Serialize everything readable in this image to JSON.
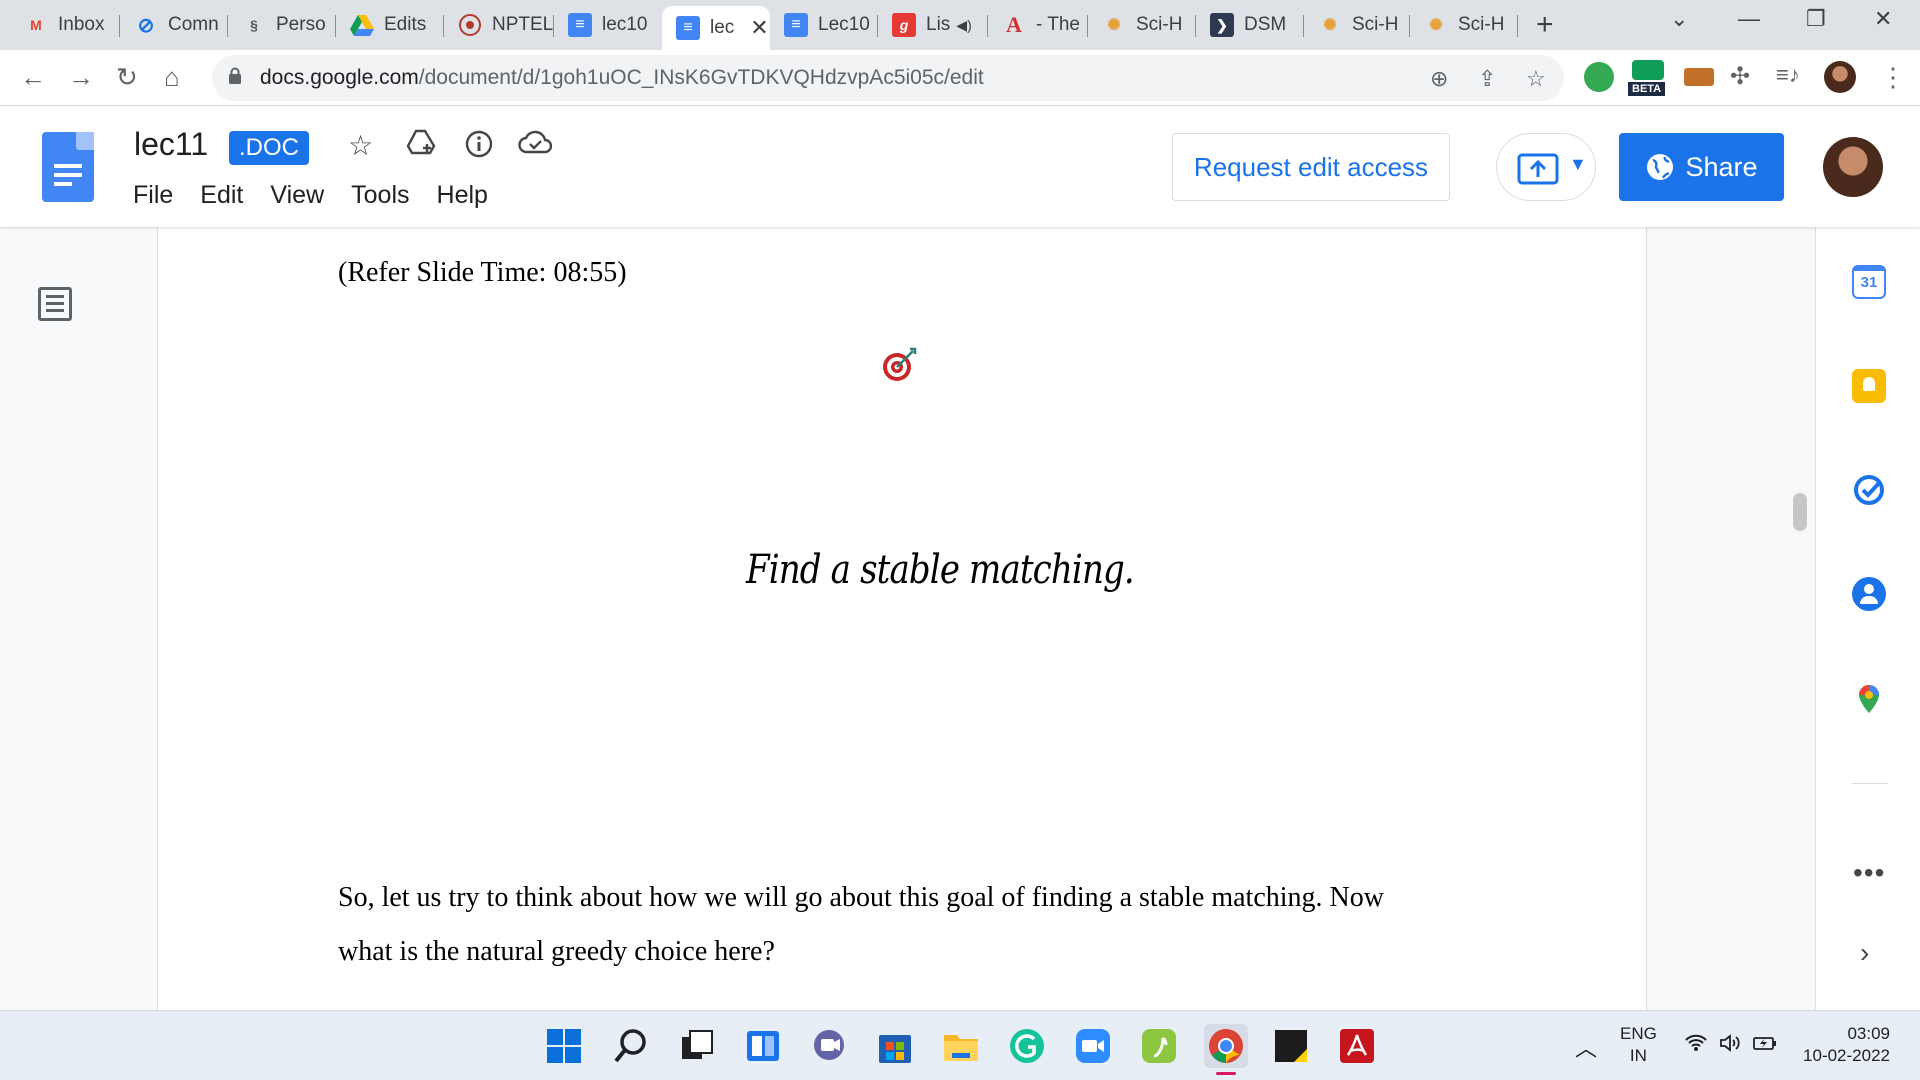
{
  "browser": {
    "tabs": [
      {
        "title": "Inbox",
        "icon": "gmail-icon",
        "color": "#ea4335"
      },
      {
        "title": "Comn",
        "icon": "link-icon",
        "color": "#1a73e8"
      },
      {
        "title": "Perso",
        "icon": "dna-icon",
        "color": "#555555"
      },
      {
        "title": "Edits",
        "icon": "drive-icon",
        "color": "#fbbc04"
      },
      {
        "title": "NPTEL",
        "icon": "nptel-icon",
        "color": "#b33a2e"
      },
      {
        "title": "lec10",
        "icon": "docs-icon",
        "color": "#4285f4"
      },
      {
        "title": "lec",
        "icon": "docs-icon",
        "color": "#4285f4",
        "active": true
      },
      {
        "title": "Lec10",
        "icon": "docs-icon",
        "color": "#4285f4"
      },
      {
        "title": "Lis",
        "icon": "g-icon",
        "color": "#e53935"
      },
      {
        "title": "- The",
        "icon": "a-icon",
        "color": "#d32f2f"
      },
      {
        "title": "Sci-H",
        "icon": "scihub-icon",
        "color": "#e8a23a"
      },
      {
        "title": "DSM",
        "icon": "arrow-icon",
        "color": "#2f3a52"
      },
      {
        "title": "Sci-H",
        "icon": "scihub-icon",
        "color": "#e8a23a"
      },
      {
        "title": "Sci-H",
        "icon": "scihub-icon",
        "color": "#e8a23a"
      }
    ],
    "url_host": "docs.google.com",
    "url_path": "/document/d/1goh1uOC_INsK6GvTDKVQHdzvpAc5i05c/edit",
    "beta_label": "BETA"
  },
  "docs": {
    "title": "lec11",
    "badge": ".DOC",
    "menu": [
      "File",
      "Edit",
      "View",
      "Tools",
      "Help"
    ],
    "request_edit": "Request edit access",
    "share": "Share",
    "accent": "#1a73e8"
  },
  "document": {
    "slide_time": "(Refer Slide Time: 08:55)",
    "slide_title": "Find a stable matching.",
    "paragraph_line1": "So, let us try to think about how we will go about this goal of finding a stable matching. Now",
    "paragraph_line2": "what is the natural greedy choice here?"
  },
  "side_panel": {
    "calendar_day": "31",
    "more": "•••",
    "expand": "›"
  },
  "taskbar": {
    "lang_line1": "ENG",
    "lang_line2": "IN",
    "time": "03:09",
    "date": "10-02-2022"
  }
}
